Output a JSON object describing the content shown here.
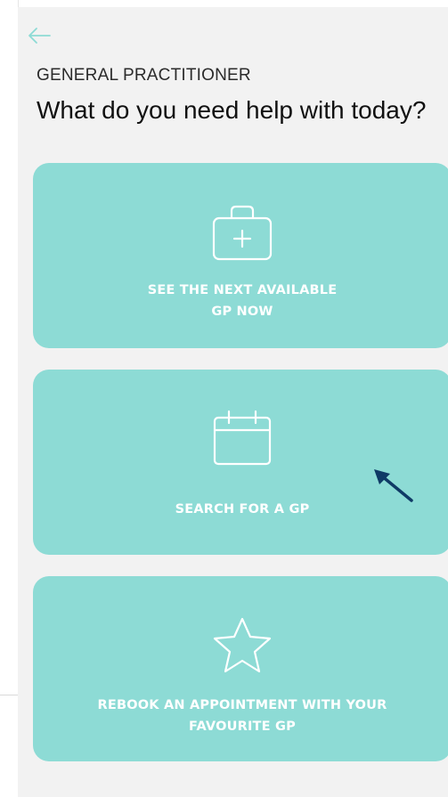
{
  "header": {
    "subtitle": "GENERAL PRACTITIONER",
    "title": "What do you need help with today?"
  },
  "options": [
    {
      "label_line1": "SEE THE NEXT AVAILABLE",
      "label_line2": "GP NOW",
      "icon": "medical-kit-icon"
    },
    {
      "label_line1": "SEARCH FOR A GP",
      "label_line2": "",
      "icon": "calendar-icon"
    },
    {
      "label_line1": "REBOOK AN APPOINTMENT WITH YOUR",
      "label_line2": "FAVOURITE GP",
      "icon": "star-icon"
    }
  ],
  "colors": {
    "accent": "#8ddbd5",
    "background": "#f2f2f2",
    "back_arrow": "#8ddbd5",
    "pointer": "#0f3a66"
  }
}
